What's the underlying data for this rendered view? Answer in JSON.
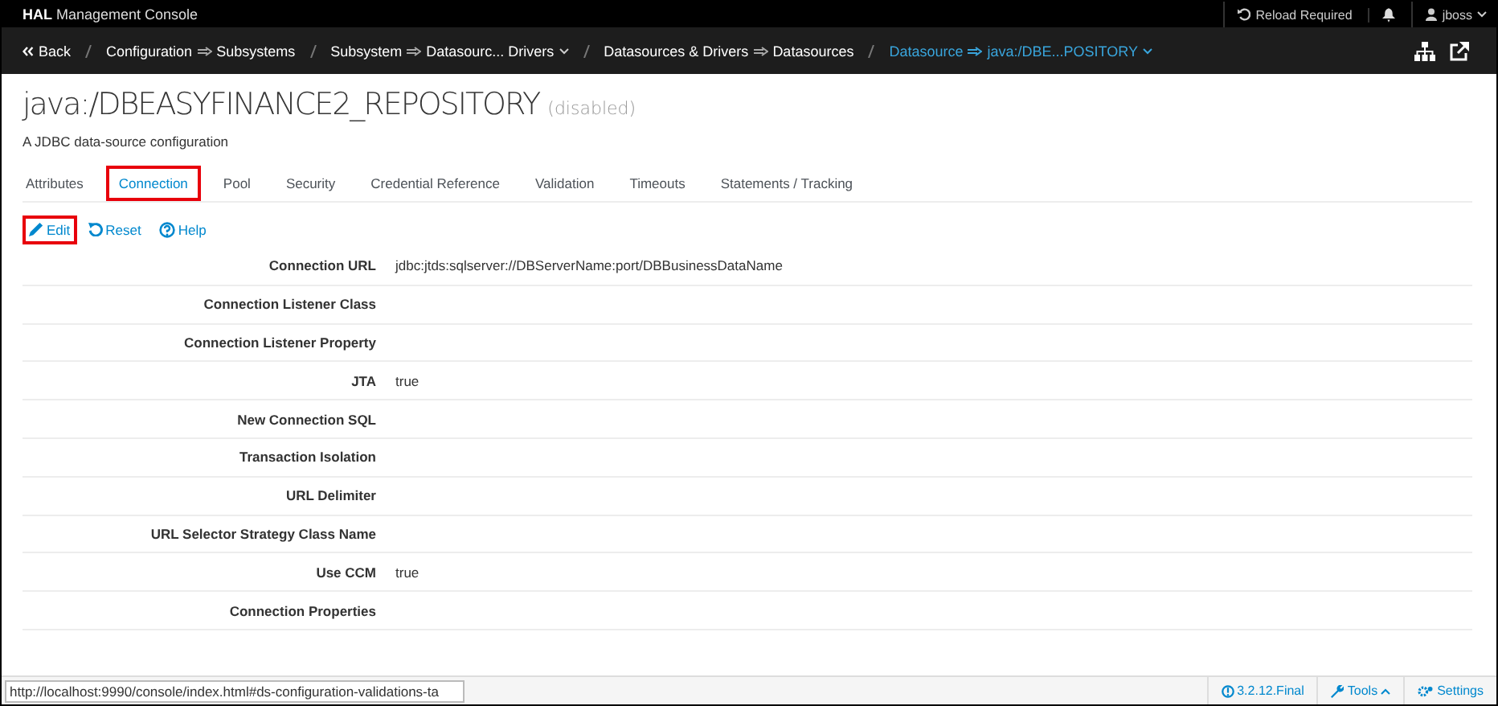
{
  "masthead": {
    "brand_bold": "HAL",
    "brand_rest": "Management Console",
    "reload": "Reload Required",
    "user": "jboss"
  },
  "breadcrumb": {
    "back": "Back",
    "items": [
      {
        "key": "Configuration",
        "value": "Subsystems",
        "dropdown": false,
        "current": false
      },
      {
        "key": "Subsystem",
        "value": "Datasourc... Drivers",
        "dropdown": true,
        "current": false
      },
      {
        "key": "Datasources & Drivers",
        "value": "Datasources",
        "dropdown": false,
        "current": false
      },
      {
        "key": "Datasource",
        "value": "java:/DBE...POSITORY",
        "dropdown": true,
        "current": true
      }
    ]
  },
  "page": {
    "title": "java:/DBEASYFINANCE2_REPOSITORY",
    "status": "(disabled)",
    "subtitle": "A JDBC data-source configuration"
  },
  "tabs": [
    {
      "label": "Attributes",
      "selected": false,
      "highlighted": false
    },
    {
      "label": "Connection",
      "selected": true,
      "highlighted": true
    },
    {
      "label": "Pool",
      "selected": false,
      "highlighted": false
    },
    {
      "label": "Security",
      "selected": false,
      "highlighted": false
    },
    {
      "label": "Credential Reference",
      "selected": false,
      "highlighted": false
    },
    {
      "label": "Validation",
      "selected": false,
      "highlighted": false
    },
    {
      "label": "Timeouts",
      "selected": false,
      "highlighted": false
    },
    {
      "label": "Statements / Tracking",
      "selected": false,
      "highlighted": false
    }
  ],
  "actions": [
    {
      "kind": "edit",
      "label": "Edit",
      "highlighted": true
    },
    {
      "kind": "reset",
      "label": "Reset",
      "highlighted": false
    },
    {
      "kind": "help",
      "label": "Help",
      "highlighted": false
    }
  ],
  "attributes": [
    {
      "label": "Connection URL",
      "value": "jdbc:jtds:sqlserver://DBServerName:port/DBBusinessDataName"
    },
    {
      "label": "Connection Listener Class"
    },
    {
      "label": "Connection Listener Property"
    },
    {
      "label": "JTA",
      "value": "true"
    },
    {
      "label": "New Connection SQL"
    },
    {
      "label": "Transaction Isolation"
    },
    {
      "label": "URL Delimiter"
    },
    {
      "label": "URL Selector Strategy Class Name"
    },
    {
      "label": "Use CCM",
      "value": "true"
    },
    {
      "label": "Connection Properties"
    }
  ],
  "status_url": "http://localhost:9990/console/index.html#ds-configuration-validations-ta",
  "footer": {
    "version": "3.2.12.Final",
    "tools": "Tools",
    "settings": "Settings"
  }
}
